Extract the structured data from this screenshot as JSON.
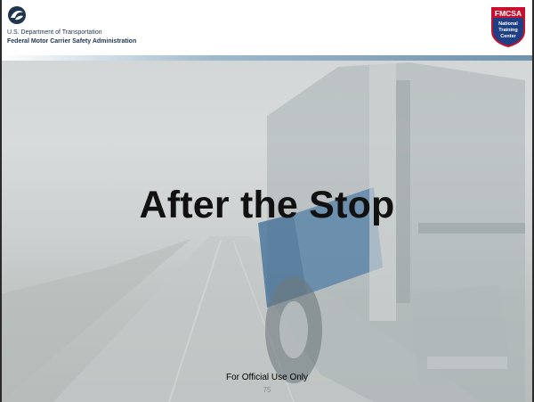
{
  "header": {
    "department": "U.S. Department of Transportation",
    "agency": "Federal Motor Carrier Safety Administration",
    "badge": {
      "top": "FMCSA",
      "line1": "National",
      "line2": "Training",
      "line3": "Center"
    }
  },
  "slide": {
    "title": "After the Stop",
    "footer": "For Official Use Only",
    "page_number": "75"
  },
  "colors": {
    "badge_red": "#c8102e",
    "badge_blue": "#1f3f84",
    "header_text": "#1e3550",
    "truck_blue": "#3d6c96"
  },
  "icons": [
    "dot-logo-icon",
    "fmcsa-badge-icon"
  ]
}
